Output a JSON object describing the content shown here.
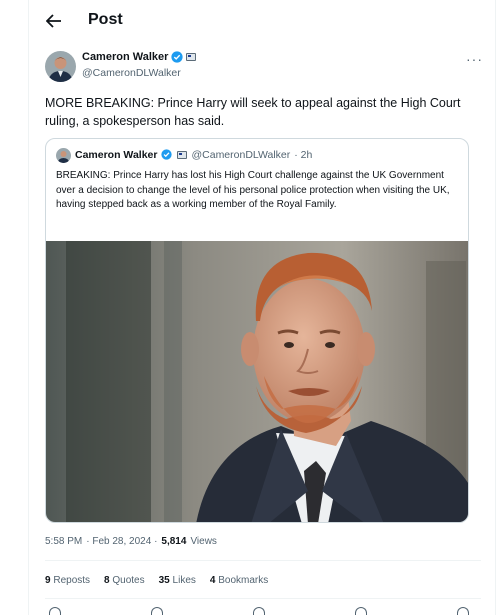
{
  "header": {
    "title": "Post"
  },
  "tweet": {
    "author_name": "Cameron Walker",
    "author_handle": "@CameronDLWalker",
    "text": "MORE BREAKING: Prince Harry will seek to appeal against the High Court ruling, a spokesperson has said."
  },
  "quote": {
    "author_name": "Cameron Walker",
    "author_handle": "@CameronDLWalker",
    "time": "· 2h",
    "text": "BREAKING: Prince Harry has lost his High Court challenge against the UK Government over a decision to change the level of his personal police protection when visiting the UK, having stepped back as a working member of the Royal Family."
  },
  "meta": {
    "time": "5:58 PM",
    "date": "· Feb 28, 2024 ·",
    "views_count": "5,814",
    "views_label": "Views"
  },
  "stats": {
    "reposts_count": "9",
    "reposts_label": "Reposts",
    "quotes_count": "8",
    "quotes_label": "Quotes",
    "likes_count": "35",
    "likes_label": "Likes",
    "bookmarks_count": "4",
    "bookmarks_label": "Bookmarks"
  },
  "colors": {
    "verified": "#1d9bf0",
    "text": "#0f1419",
    "muted": "#536471",
    "border": "#cfd9de"
  }
}
